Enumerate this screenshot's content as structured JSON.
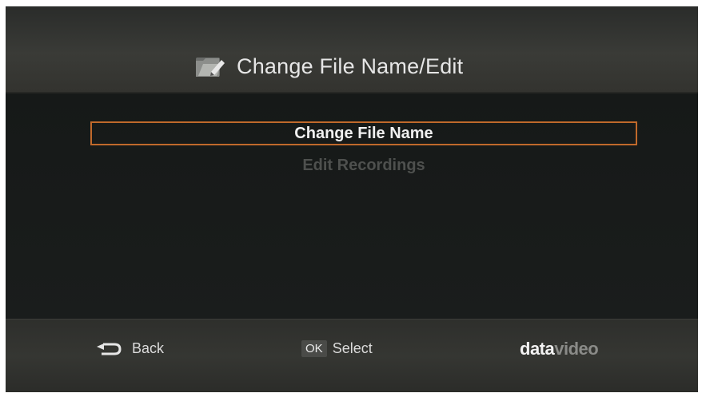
{
  "header": {
    "title": "Change File Name/Edit",
    "icon": "folder-edit-icon"
  },
  "menu": {
    "items": [
      {
        "label": "Change File Name",
        "state": "selected"
      },
      {
        "label": "Edit Recordings",
        "state": "disabled"
      }
    ]
  },
  "footer": {
    "back_icon": "back-arrow-icon",
    "back_label": "Back",
    "ok_key": "OK",
    "select_label": "Select",
    "brand_part1": "data",
    "brand_part2": "video"
  },
  "colors": {
    "selection_border": "#c0692b",
    "background": "#1b1d1c",
    "text": "#e6e6e6",
    "disabled_text": "#4e504e"
  }
}
